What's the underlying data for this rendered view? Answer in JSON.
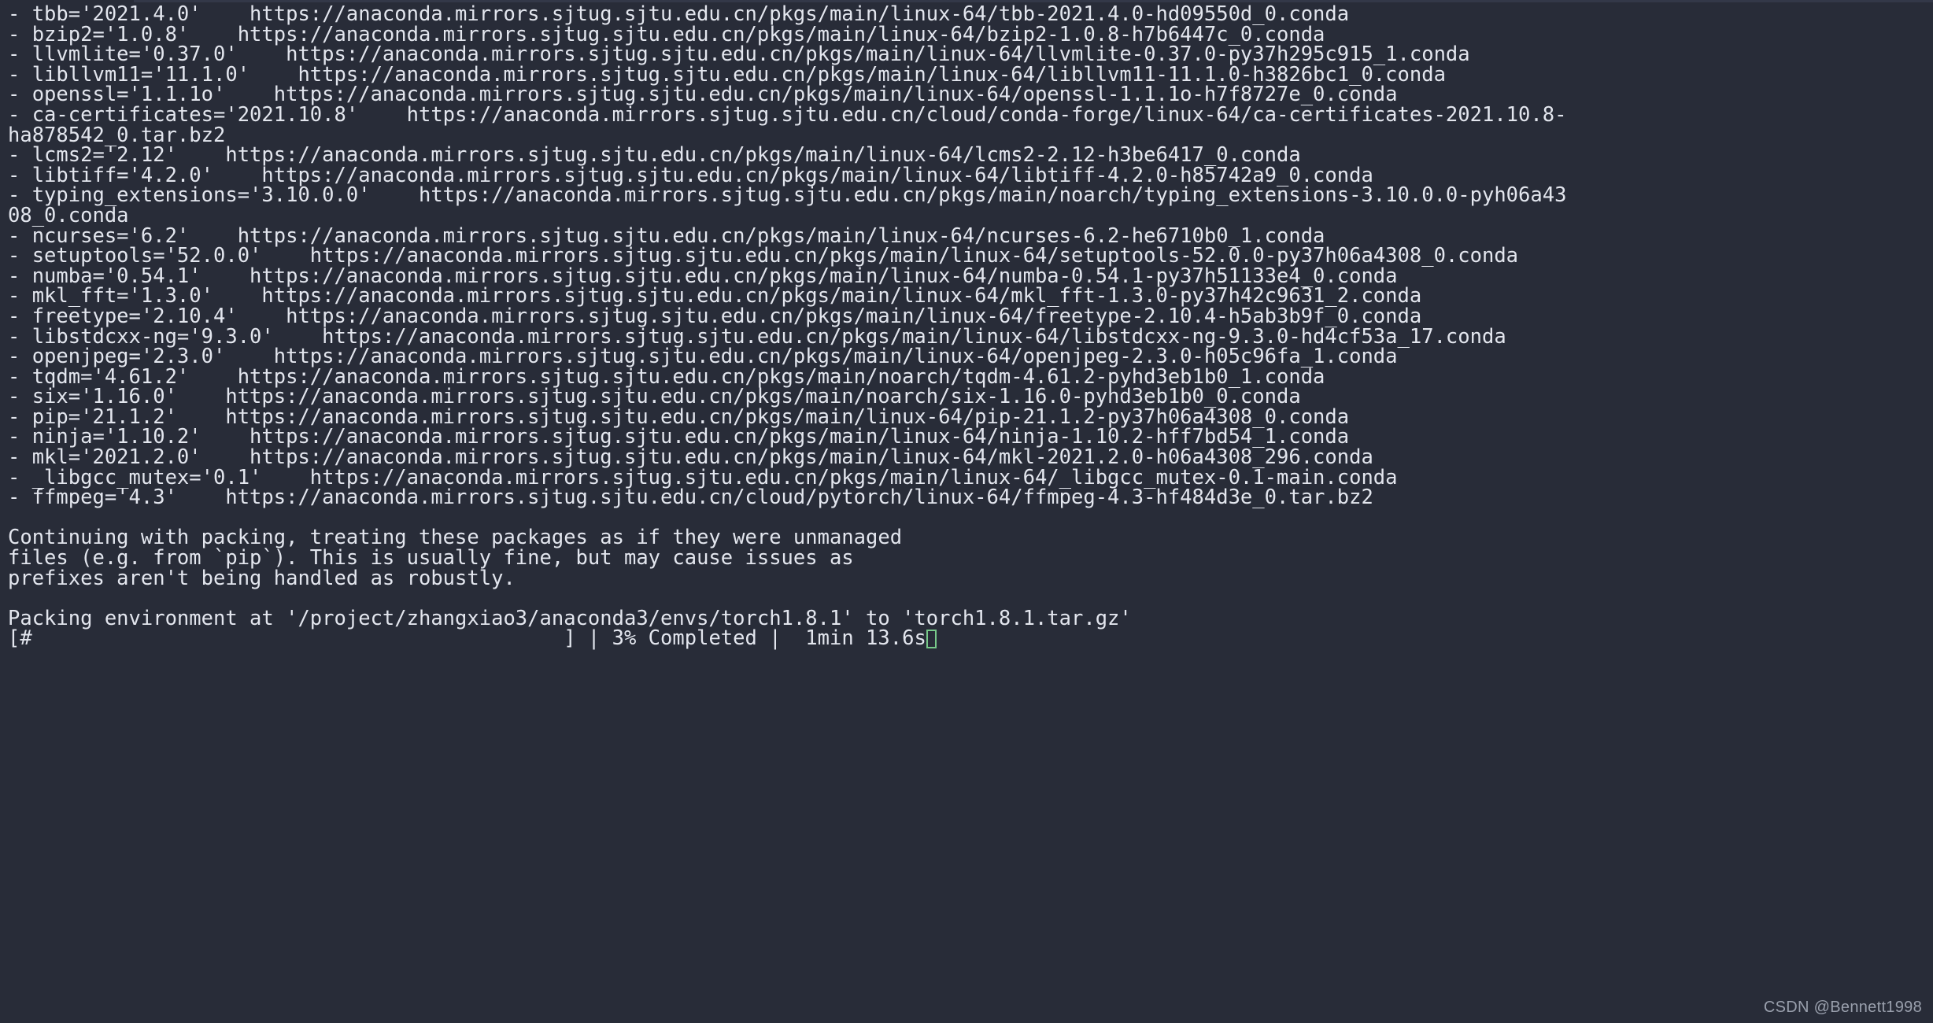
{
  "terminal": {
    "background_color": "#282c38",
    "foreground_color": "#e3e6ee",
    "cursor_color": "#78c98a",
    "lines": [
      "- tbb='2021.4.0'    https://anaconda.mirrors.sjtug.sjtu.edu.cn/pkgs/main/linux-64/tbb-2021.4.0-hd09550d_0.conda",
      "- bzip2='1.0.8'    https://anaconda.mirrors.sjtug.sjtu.edu.cn/pkgs/main/linux-64/bzip2-1.0.8-h7b6447c_0.conda",
      "- llvmlite='0.37.0'    https://anaconda.mirrors.sjtug.sjtu.edu.cn/pkgs/main/linux-64/llvmlite-0.37.0-py37h295c915_1.conda",
      "- libllvm11='11.1.0'    https://anaconda.mirrors.sjtug.sjtu.edu.cn/pkgs/main/linux-64/libllvm11-11.1.0-h3826bc1_0.conda",
      "- openssl='1.1.1o'    https://anaconda.mirrors.sjtug.sjtu.edu.cn/pkgs/main/linux-64/openssl-1.1.1o-h7f8727e_0.conda",
      "- ca-certificates='2021.10.8'    https://anaconda.mirrors.sjtug.sjtu.edu.cn/cloud/conda-forge/linux-64/ca-certificates-2021.10.8-",
      "ha878542_0.tar.bz2",
      "- lcms2='2.12'    https://anaconda.mirrors.sjtug.sjtu.edu.cn/pkgs/main/linux-64/lcms2-2.12-h3be6417_0.conda",
      "- libtiff='4.2.0'    https://anaconda.mirrors.sjtug.sjtu.edu.cn/pkgs/main/linux-64/libtiff-4.2.0-h85742a9_0.conda",
      "- typing_extensions='3.10.0.0'    https://anaconda.mirrors.sjtug.sjtu.edu.cn/pkgs/main/noarch/typing_extensions-3.10.0.0-pyh06a43",
      "08_0.conda",
      "- ncurses='6.2'    https://anaconda.mirrors.sjtug.sjtu.edu.cn/pkgs/main/linux-64/ncurses-6.2-he6710b0_1.conda",
      "- setuptools='52.0.0'    https://anaconda.mirrors.sjtug.sjtu.edu.cn/pkgs/main/linux-64/setuptools-52.0.0-py37h06a4308_0.conda",
      "- numba='0.54.1'    https://anaconda.mirrors.sjtug.sjtu.edu.cn/pkgs/main/linux-64/numba-0.54.1-py37h51133e4_0.conda",
      "- mkl_fft='1.3.0'    https://anaconda.mirrors.sjtug.sjtu.edu.cn/pkgs/main/linux-64/mkl_fft-1.3.0-py37h42c9631_2.conda",
      "- freetype='2.10.4'    https://anaconda.mirrors.sjtug.sjtu.edu.cn/pkgs/main/linux-64/freetype-2.10.4-h5ab3b9f_0.conda",
      "- libstdcxx-ng='9.3.0'    https://anaconda.mirrors.sjtug.sjtu.edu.cn/pkgs/main/linux-64/libstdcxx-ng-9.3.0-hd4cf53a_17.conda",
      "- openjpeg='2.3.0'    https://anaconda.mirrors.sjtug.sjtu.edu.cn/pkgs/main/linux-64/openjpeg-2.3.0-h05c96fa_1.conda",
      "- tqdm='4.61.2'    https://anaconda.mirrors.sjtug.sjtu.edu.cn/pkgs/main/noarch/tqdm-4.61.2-pyhd3eb1b0_1.conda",
      "- six='1.16.0'    https://anaconda.mirrors.sjtug.sjtu.edu.cn/pkgs/main/noarch/six-1.16.0-pyhd3eb1b0_0.conda",
      "- pip='21.1.2'    https://anaconda.mirrors.sjtug.sjtu.edu.cn/pkgs/main/linux-64/pip-21.1.2-py37h06a4308_0.conda",
      "- ninja='1.10.2'    https://anaconda.mirrors.sjtug.sjtu.edu.cn/pkgs/main/linux-64/ninja-1.10.2-hff7bd54_1.conda",
      "- mkl='2021.2.0'    https://anaconda.mirrors.sjtug.sjtu.edu.cn/pkgs/main/linux-64/mkl-2021.2.0-h06a4308_296.conda",
      "- _libgcc_mutex='0.1'    https://anaconda.mirrors.sjtug.sjtu.edu.cn/pkgs/main/linux-64/_libgcc_mutex-0.1-main.conda",
      "- ffmpeg='4.3'    https://anaconda.mirrors.sjtug.sjtu.edu.cn/cloud/pytorch/linux-64/ffmpeg-4.3-hf484d3e_0.tar.bz2",
      "",
      "Continuing with packing, treating these packages as if they were unmanaged",
      "files (e.g. from `pip`). This is usually fine, but may cause issues as",
      "prefixes aren't being handled as robustly.",
      "",
      "Packing environment at '/project/zhangxiao3/anaconda3/envs/torch1.8.1' to 'torch1.8.1.tar.gz'"
    ],
    "progress": {
      "bar_text": "[#                                            ]",
      "separator_1": " | ",
      "percent_text": "3% Completed",
      "separator_2": " |  ",
      "elapsed_text": "1min 13.6s",
      "percent_value": 3,
      "bar_fill_char": "#",
      "bar_width_chars": 45
    },
    "watermark": "CSDN @Bennett1998"
  }
}
